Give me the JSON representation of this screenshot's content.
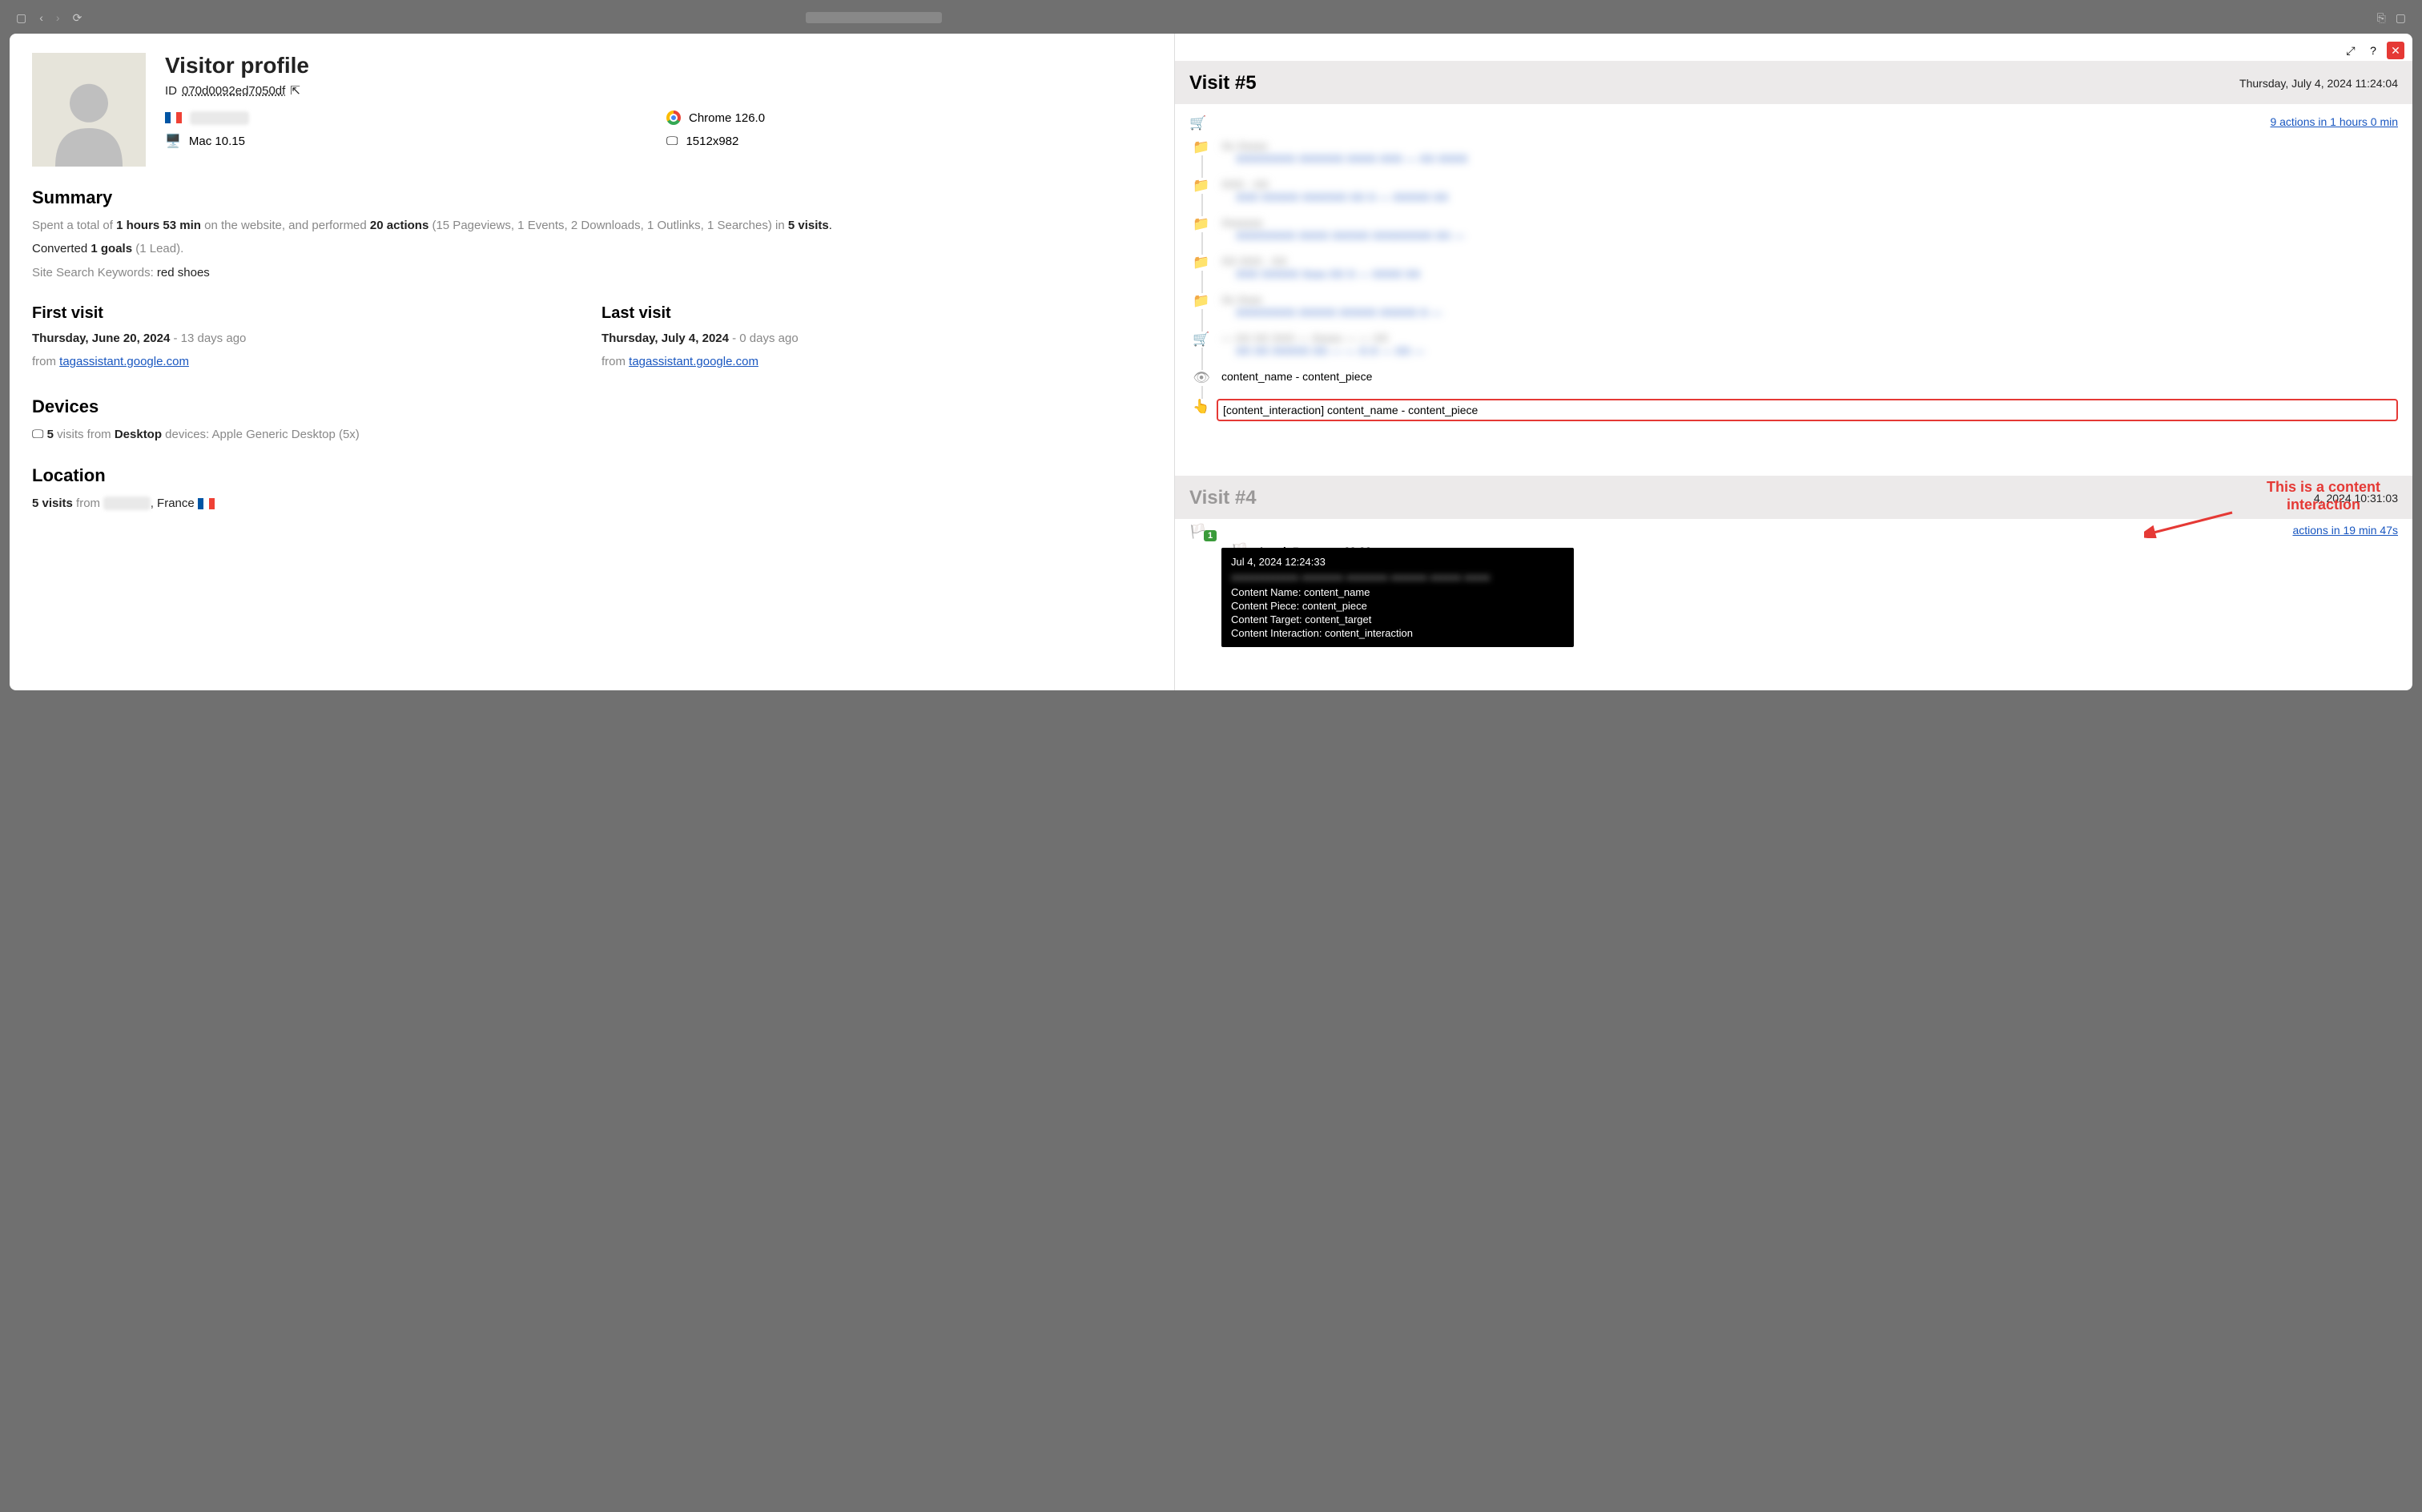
{
  "profile": {
    "title": "Visitor profile",
    "id_label": "ID",
    "id_value": "070d0092ed7050df",
    "country_name": "France",
    "browser": "Chrome 126.0",
    "os": "Mac 10.15",
    "resolution": "1512x982"
  },
  "summary": {
    "heading": "Summary",
    "prefix": "Spent a total of ",
    "duration": "1 hours 53 min",
    "mid": " on the website, and performed ",
    "actions": "20 actions",
    "breakdown": " (15 Pageviews, 1 Events, 2 Downloads, 1 Outlinks, 1 Searches) in ",
    "visits": "5 visits",
    "goals_prefix": "Converted ",
    "goals": "1 goals",
    "goals_suffix": " (1 Lead).",
    "search_prefix": "Site Search Keywords: ",
    "search_kw": "red shoes"
  },
  "first_visit": {
    "heading": "First visit",
    "date": "Thursday, June 20, 2024",
    "rel": " - 13 days ago",
    "from": "from ",
    "ref": "tagassistant.google.com"
  },
  "last_visit": {
    "heading": "Last visit",
    "date": "Thursday, July 4, 2024",
    "rel": " - 0 days ago",
    "from": "from ",
    "ref": "tagassistant.google.com"
  },
  "devices": {
    "heading": "Devices",
    "count": "5",
    "mid": " visits from ",
    "type": "Desktop",
    "suffix": " devices: Apple Generic Desktop (5x)"
  },
  "location": {
    "heading": "Location",
    "count": "5 visits",
    "mid": " from ",
    "country": ", France "
  },
  "visit5": {
    "title": "Visit #5",
    "date": "Thursday, July 4, 2024 11:24:04",
    "actions_link": "9 actions in 1 hours 0 min",
    "content_view": "content_name - content_piece",
    "content_interaction": "[content_interaction] content_name - content_piece"
  },
  "annotation": {
    "line1": "This is a content",
    "line2": "interaction"
  },
  "tooltip": {
    "date": "Jul 4, 2024 12:24:33",
    "rows": [
      "Content Name: content_name",
      "Content Piece: content_piece",
      "Content Target: content_target",
      "Content Interaction: content_interaction"
    ]
  },
  "visit4": {
    "title": "Visit #4",
    "date_suffix": "4, 2024 10:31:03",
    "actions_link_suffix": "actions in 19 min 47s",
    "goal_badge": "1",
    "goal_text": "Lead",
    "goal_rev_label": ", Revenue: ",
    "goal_rev": "€9.99"
  }
}
